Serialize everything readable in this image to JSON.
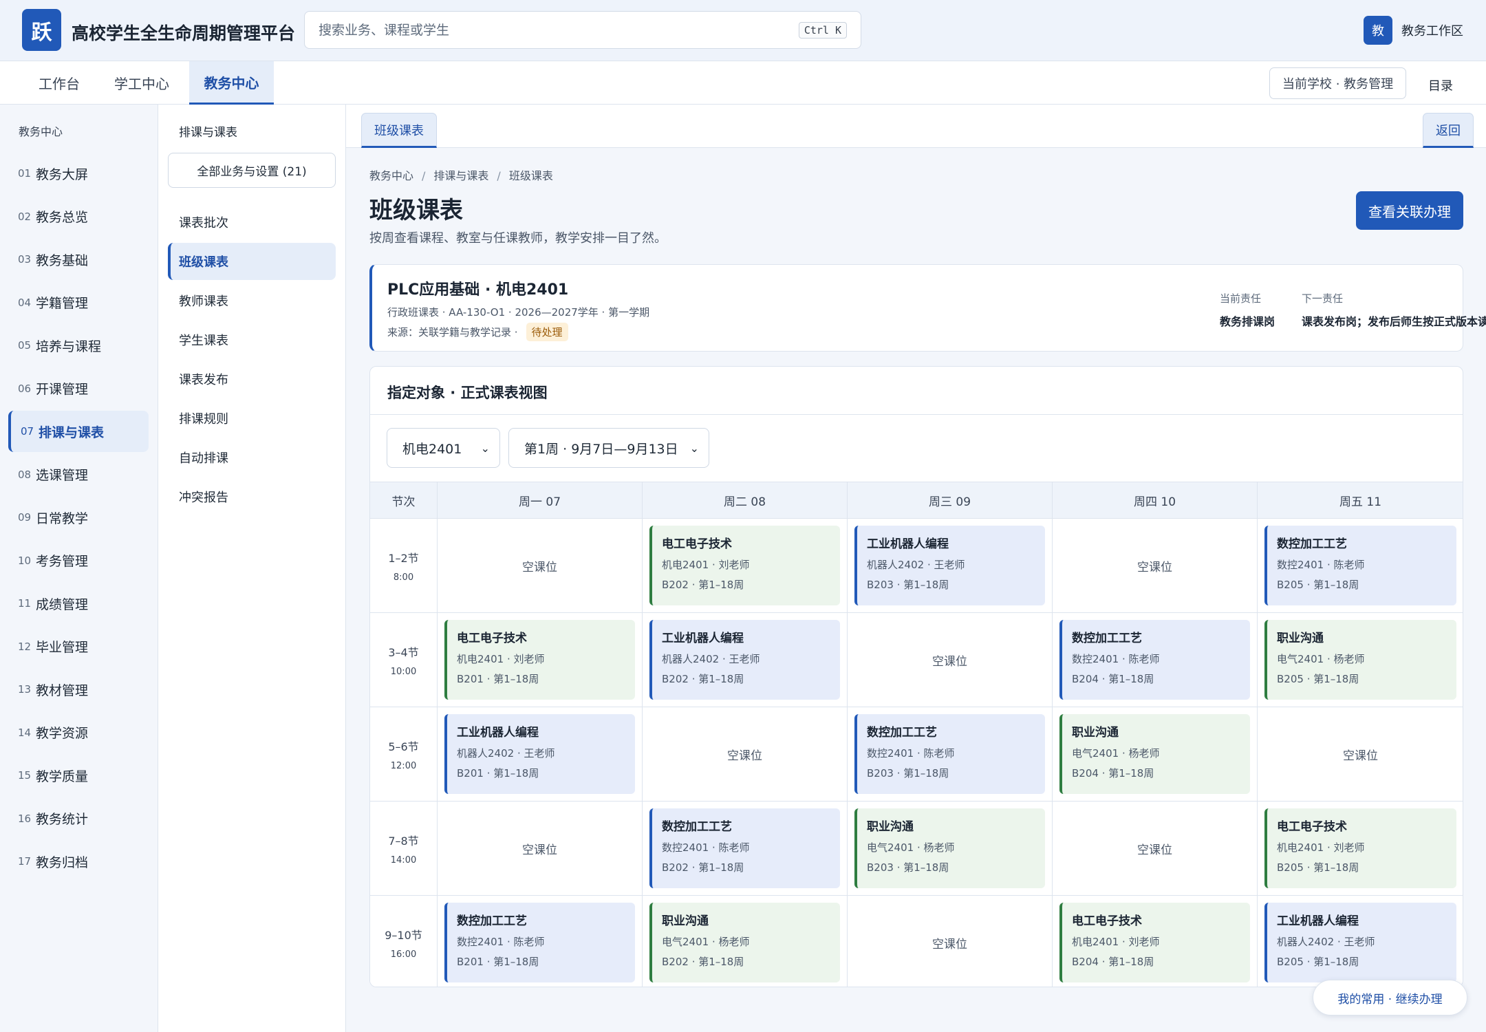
{
  "header": {
    "logo_char": "跃",
    "app_title": "高校学生全生命周期管理平台",
    "search_placeholder": "搜索业务、课程或学生",
    "search_shortcut": "Ctrl K",
    "avatar_char": "教",
    "workspace_label": "教务工作区"
  },
  "main_nav": {
    "tabs": [
      {
        "label": "工作台",
        "active": false
      },
      {
        "label": "学工中心",
        "active": false
      },
      {
        "label": "教务中心",
        "active": true
      }
    ],
    "school_chip": "当前学校 · 教务管理",
    "directory_label": "目录"
  },
  "sidebar": {
    "title": "教务中心",
    "items": [
      {
        "num": "01",
        "label": "教务大屏"
      },
      {
        "num": "02",
        "label": "教务总览"
      },
      {
        "num": "03",
        "label": "教务基础"
      },
      {
        "num": "04",
        "label": "学籍管理"
      },
      {
        "num": "05",
        "label": "培养与课程"
      },
      {
        "num": "06",
        "label": "开课管理"
      },
      {
        "num": "07",
        "label": "排课与课表",
        "active": true
      },
      {
        "num": "08",
        "label": "选课管理"
      },
      {
        "num": "09",
        "label": "日常教学"
      },
      {
        "num": "10",
        "label": "考务管理"
      },
      {
        "num": "11",
        "label": "成绩管理"
      },
      {
        "num": "12",
        "label": "毕业管理"
      },
      {
        "num": "13",
        "label": "教材管理"
      },
      {
        "num": "14",
        "label": "教学资源"
      },
      {
        "num": "15",
        "label": "教学质量"
      },
      {
        "num": "16",
        "label": "教务统计"
      },
      {
        "num": "17",
        "label": "教务归档"
      }
    ]
  },
  "subnav": {
    "title": "排课与课表",
    "all_button": "全部业务与设置 (21)",
    "items": [
      {
        "label": "课表批次"
      },
      {
        "label": "班级课表",
        "active": true
      },
      {
        "label": "教师课表"
      },
      {
        "label": "学生课表"
      },
      {
        "label": "课表发布"
      },
      {
        "label": "排课规则"
      },
      {
        "label": "自动排课"
      },
      {
        "label": "冲突报告"
      }
    ]
  },
  "content": {
    "tab_label": "班级课表",
    "back_label": "返回",
    "breadcrumb": [
      "教务中心",
      "排课与课表",
      "班级课表"
    ],
    "page_title": "班级课表",
    "page_desc": "按周查看课程、教室与任课教师，教学安排一目了然。",
    "primary_action": "查看关联办理",
    "info": {
      "title": "PLC应用基础 · 机电2401",
      "meta": "行政班课表 · AA-130-O1 · 2026—2027学年 · 第一学期",
      "source": "来源：关联学籍与教学记录 ·",
      "status": "待处理",
      "current_resp_label": "当前责任",
      "current_resp_value": "教务排课岗",
      "next_resp_label": "下一责任",
      "next_resp_value": "课表发布岗；发布后师生按正式版本读取"
    },
    "panel_title": "指定对象 · 正式课表视图",
    "class_select": "机电2401",
    "week_select": "第1周 · 9月7日—9月13日",
    "float_button": "我的常用 · 继续办理"
  },
  "schedule": {
    "period_header": "节次",
    "days": [
      "周一 07",
      "周二 08",
      "周三 09",
      "周四 10",
      "周五 11"
    ],
    "empty_label": "空课位",
    "periods": [
      {
        "label": "1–2节",
        "time": "8:00",
        "slots": [
          null,
          {
            "name": "电工电子技术",
            "teacher": "机电2401 · 刘老师",
            "room": "B202 · 第1–18周",
            "color": "green"
          },
          {
            "name": "工业机器人编程",
            "teacher": "机器人2402 · 王老师",
            "room": "B203 · 第1–18周",
            "color": "blue"
          },
          null,
          {
            "name": "数控加工工艺",
            "teacher": "数控2401 · 陈老师",
            "room": "B205 · 第1–18周",
            "color": "blue"
          }
        ]
      },
      {
        "label": "3–4节",
        "time": "10:00",
        "slots": [
          {
            "name": "电工电子技术",
            "teacher": "机电2401 · 刘老师",
            "room": "B201 · 第1–18周",
            "color": "green"
          },
          {
            "name": "工业机器人编程",
            "teacher": "机器人2402 · 王老师",
            "room": "B202 · 第1–18周",
            "color": "blue"
          },
          null,
          {
            "name": "数控加工工艺",
            "teacher": "数控2401 · 陈老师",
            "room": "B204 · 第1–18周",
            "color": "blue"
          },
          {
            "name": "职业沟通",
            "teacher": "电气2401 · 杨老师",
            "room": "B205 · 第1–18周",
            "color": "green"
          }
        ]
      },
      {
        "label": "5–6节",
        "time": "12:00",
        "slots": [
          {
            "name": "工业机器人编程",
            "teacher": "机器人2402 · 王老师",
            "room": "B201 · 第1–18周",
            "color": "blue"
          },
          null,
          {
            "name": "数控加工工艺",
            "teacher": "数控2401 · 陈老师",
            "room": "B203 · 第1–18周",
            "color": "blue"
          },
          {
            "name": "职业沟通",
            "teacher": "电气2401 · 杨老师",
            "room": "B204 · 第1–18周",
            "color": "green"
          },
          null
        ]
      },
      {
        "label": "7–8节",
        "time": "14:00",
        "slots": [
          null,
          {
            "name": "数控加工工艺",
            "teacher": "数控2401 · 陈老师",
            "room": "B202 · 第1–18周",
            "color": "blue"
          },
          {
            "name": "职业沟通",
            "teacher": "电气2401 · 杨老师",
            "room": "B203 · 第1–18周",
            "color": "green"
          },
          null,
          {
            "name": "电工电子技术",
            "teacher": "机电2401 · 刘老师",
            "room": "B205 · 第1–18周",
            "color": "green"
          }
        ]
      },
      {
        "label": "9–10节",
        "time": "16:00",
        "slots": [
          {
            "name": "数控加工工艺",
            "teacher": "数控2401 · 陈老师",
            "room": "B201 · 第1–18周",
            "color": "blue"
          },
          {
            "name": "职业沟通",
            "teacher": "电气2401 · 杨老师",
            "room": "B202 · 第1–18周",
            "color": "green"
          },
          null,
          {
            "name": "电工电子技术",
            "teacher": "机电2401 · 刘老师",
            "room": "B204 · 第1–18周",
            "color": "green"
          },
          {
            "name": "工业机器人编程",
            "teacher": "机器人2402 · 王老师",
            "room": "B205 · 第1–18周",
            "color": "blue"
          }
        ]
      }
    ]
  },
  "colors": {
    "brand": "#2159b8",
    "course_green": "#2e7d40",
    "course_blue": "#2159b8",
    "pending_bg": "#fdf0d8"
  }
}
